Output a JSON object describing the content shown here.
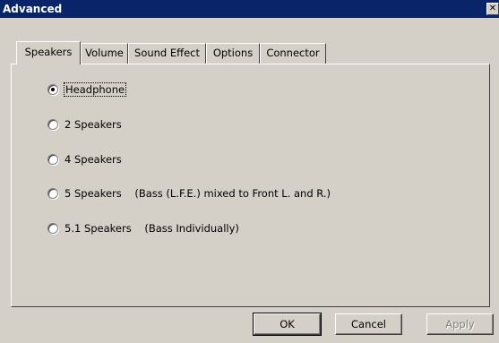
{
  "window": {
    "title": "Advanced",
    "close_glyph": "✕"
  },
  "tabs": [
    {
      "label": "Speakers",
      "active": true
    },
    {
      "label": "Volume",
      "active": false
    },
    {
      "label": "Sound Effect",
      "active": false
    },
    {
      "label": "Options",
      "active": false
    },
    {
      "label": "Connector",
      "active": false
    }
  ],
  "speaker_options": [
    {
      "label": "Headphone",
      "selected": true
    },
    {
      "label": "2 Speakers",
      "selected": false
    },
    {
      "label": "4 Speakers",
      "selected": false
    },
    {
      "label": "5 Speakers    (Bass (L.F.E.) mixed to Front L. and R.)",
      "selected": false
    },
    {
      "label": "5.1 Speakers    (Bass Individually)",
      "selected": false
    }
  ],
  "buttons": {
    "ok": "OK",
    "cancel": "Cancel",
    "apply": "Apply"
  }
}
